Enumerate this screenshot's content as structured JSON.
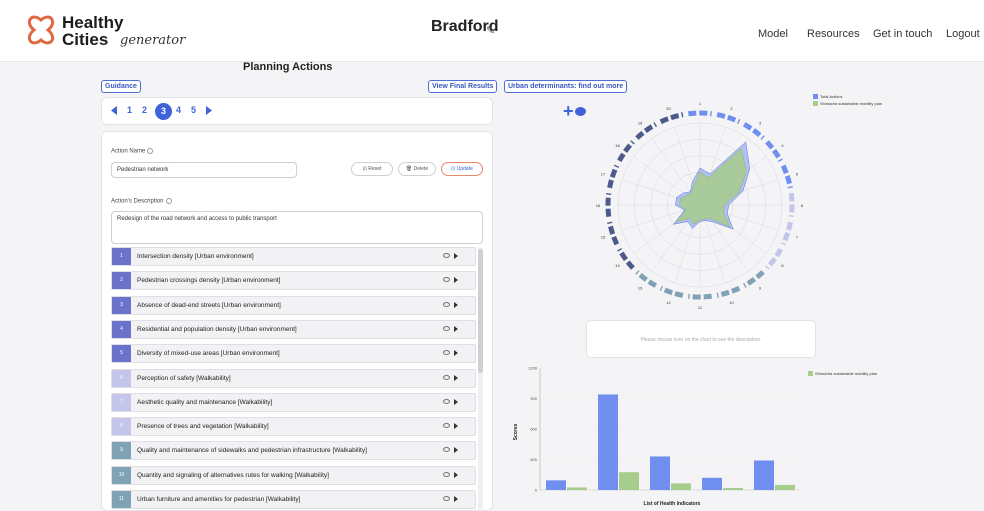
{
  "header": {
    "logo_line1": "Healthy",
    "logo_line2": "Cities",
    "logo_script": "generator",
    "city": "Bradford",
    "nav": [
      "Model",
      "Resources",
      "Get in touch",
      "Logout"
    ]
  },
  "planning": {
    "title": "Planning Actions",
    "guidance": "Guidance",
    "view_results": "View Final Results",
    "determinants": "Urban determinants: find out more",
    "pages": [
      "1",
      "2",
      "3",
      "4",
      "5"
    ],
    "active_page": "3",
    "action_name_label": "Action Name",
    "action_name_value": "Pedestrian network",
    "reset": "Reset",
    "delete": "Delete",
    "update": "Update",
    "description_label": "Action's Description",
    "description_value": "Redesign of the road network and access to public transport",
    "indicators": [
      {
        "num": "1",
        "label": "Intersection density [Urban environment]",
        "color": "#6b72c9"
      },
      {
        "num": "2",
        "label": "Pedestrian crossings density  [Urban environment]",
        "color": "#6b72c9"
      },
      {
        "num": "3",
        "label": "Absence of dead-end streets  [Urban environment]",
        "color": "#6b72c9"
      },
      {
        "num": "4",
        "label": "Residential and population density  [Urban environment]",
        "color": "#6b72c9"
      },
      {
        "num": "5",
        "label": "Diversity of mixed-use areas  [Urban environment]",
        "color": "#6b72c9"
      },
      {
        "num": "6",
        "label": "Perception of safety [Walkability]",
        "color": "#c3c5ea"
      },
      {
        "num": "7",
        "label": "Aesthetic quality and maintenance [Walkability]",
        "color": "#c3c5ea"
      },
      {
        "num": "8",
        "label": "Presence of trees and vegetation [Walkability]",
        "color": "#c3c5ea"
      },
      {
        "num": "9",
        "label": "Quality and maintenance of sidewalks and pedestrian infrastructure [Walkability]",
        "color": "#7fa2b4"
      },
      {
        "num": "10",
        "label": "Quantity and signaling of alternatives rutes for walking [Walkability]",
        "color": "#7fa2b4"
      },
      {
        "num": "11",
        "label": " Urban furniture and amenities for pedestrian [Walkability]",
        "color": "#7fa2b4"
      }
    ]
  },
  "charts": {
    "radar_legend": [
      "Total Actions",
      "Shinsicha sustainable mobility plan"
    ],
    "description_hint": "Please mouse over on the chart to see the description.",
    "bar_legend": "Shinsicha sustainable mobility plan",
    "bar_ylabel": "Scores",
    "bar_xlabel": "List of Health Indicators",
    "colors": {
      "blue": "#6f8ef0",
      "green": "#a7cd8c"
    }
  },
  "chart_data": [
    {
      "type": "radar",
      "categories": [
        "1",
        "2",
        "3",
        "4",
        "5",
        "6",
        "7",
        "8",
        "9",
        "10",
        "11",
        "12",
        "13",
        "14",
        "15",
        "16",
        "17",
        "18",
        "19",
        "20"
      ],
      "series": [
        {
          "name": "Total Actions",
          "values": [
            0.45,
            0.4,
            0.95,
            0.75,
            0.55,
            0.35,
            0.35,
            0.5,
            0.25,
            0.2,
            0.2,
            0.3,
            0.25,
            0.4,
            0.2,
            0.3,
            0.3,
            0.25,
            0.2,
            0.3
          ]
        },
        {
          "name": "Shinsicha sustainable mobility plan",
          "values": [
            0.4,
            0.35,
            0.85,
            0.7,
            0.5,
            0.3,
            0.3,
            0.45,
            0.2,
            0.18,
            0.18,
            0.25,
            0.2,
            0.35,
            0.18,
            0.25,
            0.25,
            0.2,
            0.18,
            0.25
          ]
        }
      ]
    },
    {
      "type": "bar",
      "categories": [
        "",
        "",
        "",
        "",
        ""
      ],
      "series": [
        {
          "name": "Total Actions",
          "values": [
            95,
            940,
            330,
            120,
            290
          ]
        },
        {
          "name": "Shinsicha sustainable mobility plan",
          "values": [
            25,
            175,
            65,
            20,
            50
          ]
        }
      ],
      "ylabel": "Scores",
      "xlabel": "List of Health Indicators",
      "yticks": [
        "0",
        "500",
        "600",
        "900",
        "1200"
      ],
      "ylim": [
        0,
        1200
      ]
    }
  ]
}
